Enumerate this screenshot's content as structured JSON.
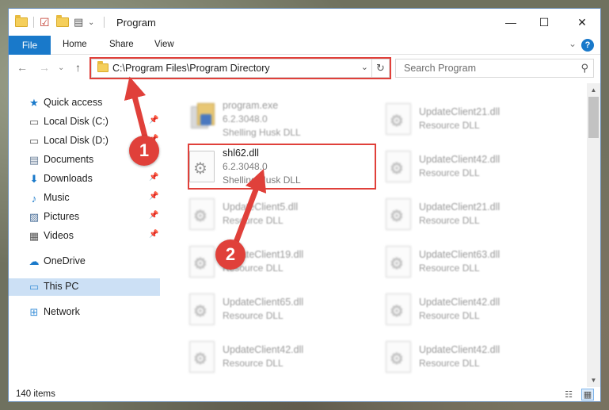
{
  "window": {
    "title": "Program",
    "controls": {
      "minimize": "—",
      "maximize": "☐",
      "close": "✕"
    }
  },
  "quick_access_toolbar": [
    "folder-icon",
    "properties-icon",
    "new-folder-icon",
    "customize-icon"
  ],
  "ribbon": {
    "tabs": [
      "File",
      "Home",
      "Share",
      "View"
    ],
    "help": "?",
    "collapse": "⌄"
  },
  "navigation": {
    "back": "←",
    "forward": "→",
    "recent": "⌄",
    "up": "↑",
    "address": "C:\\Program Files\\Program Directory",
    "address_dropdown": "⌄",
    "refresh": "↻",
    "search_placeholder": "Search Program",
    "search_icon": "⚲"
  },
  "sidebar": {
    "items": [
      {
        "label": "Quick access",
        "icon": "star-icon",
        "glyph": "★",
        "pinned": false,
        "selected": false,
        "color": "#1979ca"
      },
      {
        "label": "Local Disk (C:)",
        "icon": "drive-icon",
        "glyph": "▭",
        "pinned": true,
        "selected": false,
        "color": "#5a5a5a"
      },
      {
        "label": "Local Disk (D:)",
        "icon": "drive-icon",
        "glyph": "▭",
        "pinned": true,
        "selected": false,
        "color": "#5a5a5a"
      },
      {
        "label": "Documents",
        "icon": "documents-icon",
        "glyph": "▤",
        "pinned": true,
        "selected": false,
        "color": "#6a7f99"
      },
      {
        "label": "Downloads",
        "icon": "downloads-icon",
        "glyph": "⬇",
        "pinned": true,
        "selected": false,
        "color": "#1979ca"
      },
      {
        "label": "Music",
        "icon": "music-icon",
        "glyph": "♪",
        "pinned": true,
        "selected": false,
        "color": "#1979ca"
      },
      {
        "label": "Pictures",
        "icon": "pictures-icon",
        "glyph": "▨",
        "pinned": true,
        "selected": false,
        "color": "#4a6f99"
      },
      {
        "label": "Videos",
        "icon": "videos-icon",
        "glyph": "▦",
        "pinned": true,
        "selected": false,
        "color": "#555555"
      },
      {
        "label": "OneDrive",
        "icon": "onedrive-icon",
        "glyph": "☁",
        "pinned": false,
        "selected": false,
        "color": "#1979ca"
      },
      {
        "label": "This PC",
        "icon": "computer-icon",
        "glyph": "▭",
        "pinned": false,
        "selected": true,
        "color": "#3a8fd8"
      },
      {
        "label": "Network",
        "icon": "network-icon",
        "glyph": "⊞",
        "pinned": false,
        "selected": false,
        "color": "#3a8fd8"
      }
    ],
    "pin_glyph": "📌"
  },
  "files": [
    {
      "name": "program.exe",
      "version": "6.2.3048.0",
      "description": "Shelling Husk DLL",
      "kind": "exe",
      "blurred": true,
      "highlighted": false
    },
    {
      "name": "UpdateClient21.dll",
      "version": "",
      "description": "Resource DLL",
      "kind": "dll",
      "blurred": true,
      "highlighted": false
    },
    {
      "name": "shl62.dll",
      "version": "6.2.3048.0",
      "description": "Shelling Husk DLL",
      "kind": "dll",
      "blurred": false,
      "highlighted": true
    },
    {
      "name": "UpdateClient42.dll",
      "version": "",
      "description": "Resource DLL",
      "kind": "dll",
      "blurred": true,
      "highlighted": false
    },
    {
      "name": "UpdateClient5.dll",
      "version": "",
      "description": "Resource DLL",
      "kind": "dll",
      "blurred": true,
      "highlighted": false
    },
    {
      "name": "UpdateClient21.dll",
      "version": "",
      "description": "Resource DLL",
      "kind": "dll",
      "blurred": true,
      "highlighted": false
    },
    {
      "name": "UpdateClient19.dll",
      "version": "",
      "description": "Resource DLL",
      "kind": "dll",
      "blurred": true,
      "highlighted": false
    },
    {
      "name": "UpdateClient63.dll",
      "version": "",
      "description": "Resource DLL",
      "kind": "dll",
      "blurred": true,
      "highlighted": false
    },
    {
      "name": "UpdateClient65.dll",
      "version": "",
      "description": "Resource DLL",
      "kind": "dll",
      "blurred": true,
      "highlighted": false
    },
    {
      "name": "UpdateClient42.dll",
      "version": "",
      "description": "Resource DLL",
      "kind": "dll",
      "blurred": true,
      "highlighted": false
    },
    {
      "name": "UpdateClient42.dll",
      "version": "",
      "description": "Resource DLL",
      "kind": "dll",
      "blurred": true,
      "highlighted": false
    },
    {
      "name": "UpdateClient42.dll",
      "version": "",
      "description": "Resource DLL",
      "kind": "dll",
      "blurred": true,
      "highlighted": false
    }
  ],
  "status": {
    "item_count": "140 items",
    "details_view": "☷",
    "tiles_view": "▦"
  },
  "callouts": [
    "1",
    "2"
  ],
  "colors": {
    "accent": "#1979ca",
    "highlight": "#e0403a",
    "selected_nav": "#cce0f5"
  }
}
